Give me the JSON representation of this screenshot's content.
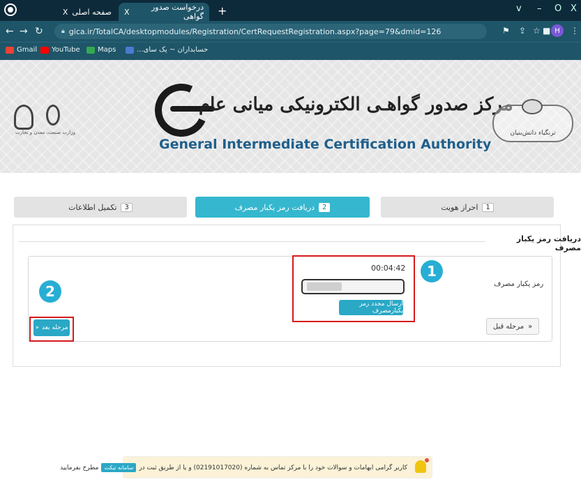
{
  "browser": {
    "tabs": [
      {
        "title": "صفحه اصلی",
        "close": "X"
      },
      {
        "title": "درخواست صدور گواهی",
        "close": "X"
      }
    ],
    "new_tab": "+",
    "window_controls": [
      "v",
      "–",
      "O",
      "X"
    ],
    "url": "gica.ir/TotalCA/desktopmodules/Registration/CertRequestRegistration.aspx?page=79&dmid=126",
    "avatar": "H",
    "bookmarks": [
      {
        "label": "Gmail",
        "icon": "gmail-icon",
        "color": "#ea4335"
      },
      {
        "label": "YouTube",
        "icon": "youtube-icon",
        "color": "#ff0000"
      },
      {
        "label": "Maps",
        "icon": "maps-icon",
        "color": "#34a853"
      },
      {
        "label": "حسابداران ~ یک سای...",
        "icon": "site-icon",
        "color": "#4a7bd0"
      }
    ]
  },
  "header": {
    "title_fa": "مرکز صدور گواهـی الکترونیکی میانی عام",
    "title_en": "General Intermediate Certification Authority",
    "badge_text": "ترنگیاء دانش‌بنیان",
    "emblem_text": "وزارت صنعت، معدن و تجارت"
  },
  "steps": [
    {
      "num": "1",
      "label": "احراز هویت"
    },
    {
      "num": "2",
      "label": "دریافت رمز یکبار مصرف"
    },
    {
      "num": "3",
      "label": "تکمیل اطلاعات"
    }
  ],
  "panel": {
    "title": "دریافت رمز یکبار مصرف",
    "otp_label": "رمز یکبار مصرف",
    "timer": "00:04:42",
    "resend_label": "ارسال مجدد رمز یکبارمصرف",
    "prev_label": "مرحله قبل",
    "prev_arrow": "«",
    "next_label": "مرحله بعد",
    "next_arrow": "«",
    "marker1": "1",
    "marker2": "2"
  },
  "notice": {
    "text_before": "کاربر گرامی ابهامات و سوالات خود را با مرکز تماس به شماره (02191017020) و یا از طریق ثبت در",
    "ticket_label": "سامانه تیکت",
    "text_after": "مطرح بفرمایید"
  },
  "colors": {
    "accent": "#35b7cf",
    "annotation_red": "#d7191c",
    "chrome_dark": "#0d2a3a",
    "chrome": "#1f5568"
  }
}
